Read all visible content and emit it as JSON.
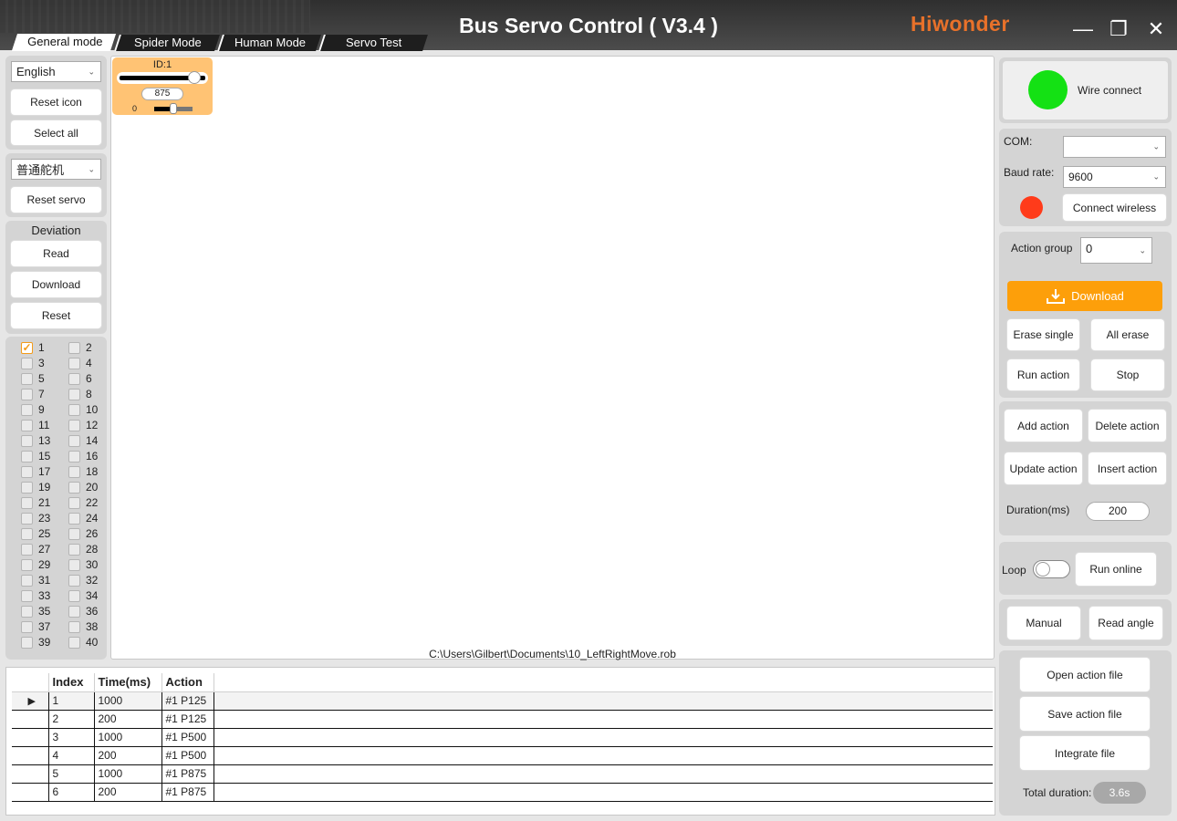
{
  "app": {
    "title": "Bus Servo Control ( V3.4 )",
    "brand": "Hiwonder",
    "minimize": "—",
    "maximize": "❐",
    "close": "✕"
  },
  "tabs": [
    "General mode",
    "Spider Mode",
    "Human Mode",
    "Servo Test"
  ],
  "left": {
    "language": "English",
    "reset_icon": "Reset icon",
    "select_all": "Select all",
    "servo_type": "普通舵机",
    "reset_servo": "Reset servo",
    "deviation": {
      "title": "Deviation",
      "read": "Read",
      "download": "Download",
      "reset": "Reset"
    },
    "servo_ids": [
      "1",
      "2",
      "3",
      "4",
      "5",
      "6",
      "7",
      "8",
      "9",
      "10",
      "11",
      "12",
      "13",
      "14",
      "15",
      "16",
      "17",
      "18",
      "19",
      "20",
      "21",
      "22",
      "23",
      "24",
      "25",
      "26",
      "27",
      "28",
      "29",
      "30",
      "31",
      "32",
      "33",
      "34",
      "35",
      "36",
      "37",
      "38",
      "39",
      "40"
    ],
    "checked": [
      "1"
    ]
  },
  "servo_card": {
    "id_label": "ID:1",
    "value": "875",
    "dev_value": "0",
    "position_fraction": 0.875,
    "dev_fraction": 0.5
  },
  "file_path": "C:\\Users\\Gilbert\\Documents\\10_LeftRightMove.rob",
  "table": {
    "headers": [
      "Index",
      "Time(ms)",
      "Action"
    ],
    "rows": [
      {
        "index": "1",
        "time": "1000",
        "action": "#1 P125",
        "selected": true
      },
      {
        "index": "2",
        "time": "200",
        "action": "#1 P125"
      },
      {
        "index": "3",
        "time": "1000",
        "action": "#1 P500"
      },
      {
        "index": "4",
        "time": "200",
        "action": "#1 P500"
      },
      {
        "index": "5",
        "time": "1000",
        "action": "#1 P875"
      },
      {
        "index": "6",
        "time": "200",
        "action": "#1 P875"
      }
    ]
  },
  "right": {
    "wire_connect": "Wire connect",
    "wire_status_color": "#14e114",
    "com_label": "COM:",
    "com_value": "",
    "baud_label": "Baud rate:",
    "baud_value": "9600",
    "wireless_status_color": "#ff3b1a",
    "connect_wireless": "Connect wireless",
    "action_group_label": "Action group",
    "action_group_value": "0",
    "download": "Download",
    "erase_single": "Erase single",
    "all_erase": "All erase",
    "run_action": "Run action",
    "stop": "Stop",
    "add_action": "Add action",
    "delete_action": "Delete action",
    "update_action": "Update action",
    "insert_action": "Insert action",
    "duration_label": "Duration(ms)",
    "duration_value": "200",
    "loop_label": "Loop",
    "run_online": "Run online",
    "manual": "Manual",
    "read_angle": "Read angle",
    "open_action_file": "Open action file",
    "save_action_file": "Save action file",
    "integrate_file": "Integrate file",
    "total_duration_label": "Total duration:",
    "total_duration_value": "3.6s"
  },
  "colors": {
    "accent": "#fd9f0a",
    "card": "#ffc374"
  }
}
